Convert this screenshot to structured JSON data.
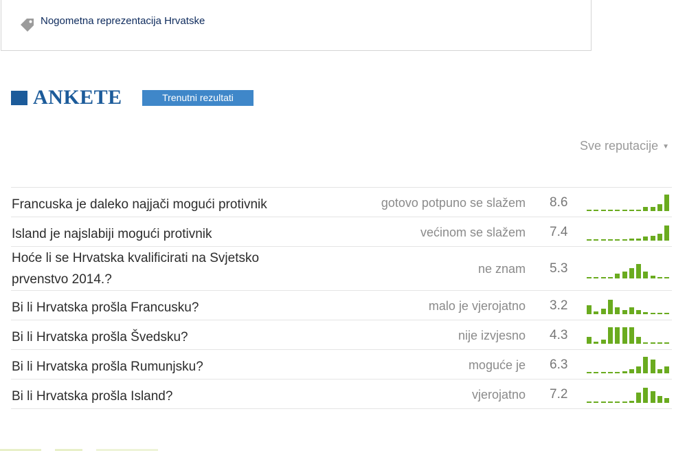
{
  "tag": {
    "icon": "tag-icon",
    "label": "Nogometna reprezentacija Hrvatske"
  },
  "polls_header": {
    "title": "ANKETE",
    "results_button": "Trenutni rezultati",
    "filter": "Sve reputacije",
    "filter_icon": "caret-down-icon"
  },
  "colors": {
    "brand_blue": "#1c5b9a",
    "button_blue": "#3f87c9",
    "bar_green": "#6aab1f"
  },
  "polls": [
    {
      "question": "Francuska je daleko najjači mogući protivnik",
      "answer": "gotovo potpuno se slažem",
      "score": "8.6",
      "distribution": [
        0.03,
        0.03,
        0.03,
        0.03,
        0.03,
        0.03,
        0.03,
        0.03,
        0.22,
        0.22,
        0.35,
        0.85
      ]
    },
    {
      "question": "Island je najslabiji mogući protivnik",
      "answer": "većinom se slažem",
      "score": "7.4",
      "distribution": [
        0.03,
        0.03,
        0.03,
        0.03,
        0.03,
        0.06,
        0.1,
        0.1,
        0.22,
        0.25,
        0.35,
        0.8
      ]
    },
    {
      "question": "Hoće li se Hrvatska kvalificirati na Svjetsko prvenstvo 2014.?",
      "answer": "ne znam",
      "score": "5.3",
      "distribution": [
        0.03,
        0.03,
        0.03,
        0.03,
        0.25,
        0.35,
        0.55,
        0.75,
        0.35,
        0.14,
        0.03,
        0.03
      ]
    },
    {
      "question": "Bi li Hrvatska prošla Francusku?",
      "answer": "malo je vjerojatno",
      "score": "3.2",
      "distribution": [
        0.45,
        0.15,
        0.3,
        0.75,
        0.35,
        0.22,
        0.35,
        0.2,
        0.1,
        0.03,
        0.03,
        0.03
      ]
    },
    {
      "question": "Bi li Hrvatska prošla Švedsku?",
      "answer": "nije izvjesno",
      "score": "4.3",
      "distribution": [
        0.35,
        0.1,
        0.22,
        0.85,
        0.85,
        0.85,
        0.85,
        0.35,
        0.03,
        0.03,
        0.03,
        0.03
      ]
    },
    {
      "question": "Bi li Hrvatska prošla Rumunjsku?",
      "answer": "moguće je",
      "score": "6.3",
      "distribution": [
        0.03,
        0.03,
        0.03,
        0.03,
        0.06,
        0.1,
        0.22,
        0.35,
        0.85,
        0.7,
        0.22,
        0.35
      ]
    },
    {
      "question": "Bi li Hrvatska prošla Island?",
      "answer": "vjerojatno",
      "score": "7.2",
      "distribution": [
        0.03,
        0.03,
        0.03,
        0.03,
        0.03,
        0.03,
        0.12,
        0.55,
        0.8,
        0.6,
        0.35,
        0.25
      ]
    }
  ]
}
